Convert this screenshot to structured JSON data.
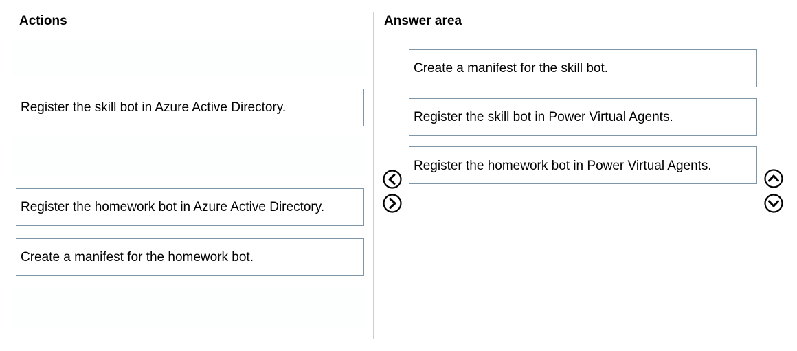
{
  "actions": {
    "heading": "Actions",
    "items": [
      "Register the skill bot in Azure Active Directory.",
      "Register the homework bot in Azure Active Directory.",
      "Create a manifest for the homework bot."
    ]
  },
  "answer_area": {
    "heading": "Answer area",
    "items": [
      "Create a manifest for the skill bot.",
      "Register the skill bot in Power Virtual Agents.",
      "Register the homework bot in Power Virtual Agents."
    ]
  },
  "controls": {
    "move_left": "chevron-left-circle",
    "move_right": "chevron-right-circle",
    "move_up": "chevron-up-circle",
    "move_down": "chevron-down-circle"
  }
}
